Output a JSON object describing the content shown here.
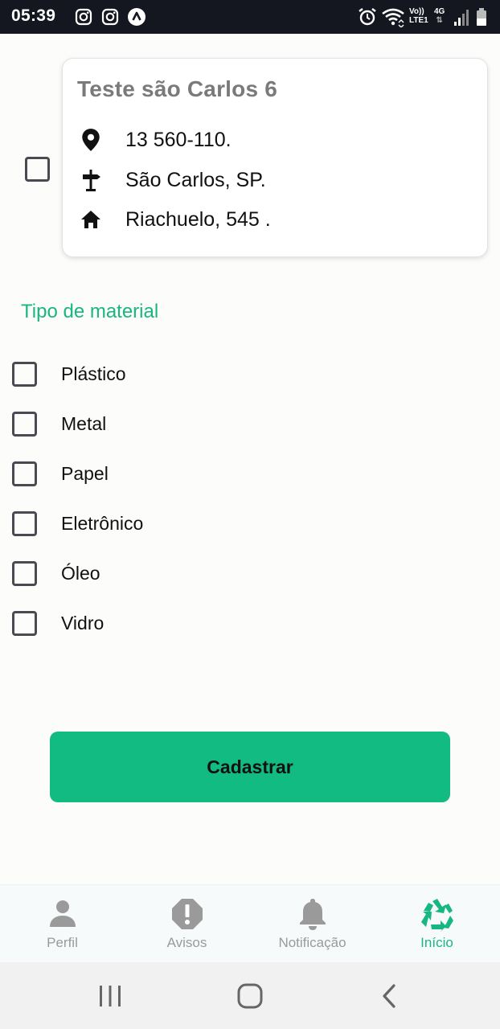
{
  "status_bar": {
    "time": "05:39",
    "icons_left": [
      "instagram-icon",
      "instagram-icon",
      "app-notification-icon"
    ],
    "icons_right": [
      "alarm-icon",
      "wifi-icon",
      "volte-lte1-icon",
      "4g-data-icon",
      "signal-icon",
      "battery-icon"
    ],
    "network_label_1": "Vo))",
    "network_label_2": "LTE1",
    "data_label": "4G"
  },
  "address_card": {
    "title": "Teste são Carlos 6",
    "cep": "13 560-110.",
    "city": "São Carlos, SP.",
    "street": "Riachuelo, 545 .",
    "checked": false
  },
  "material_section": {
    "title": "Tipo de material",
    "options": [
      {
        "label": "Plástico",
        "checked": false
      },
      {
        "label": "Metal",
        "checked": false
      },
      {
        "label": "Papel",
        "checked": false
      },
      {
        "label": "Eletrônico",
        "checked": false
      },
      {
        "label": "Óleo",
        "checked": false
      },
      {
        "label": "Vidro",
        "checked": false
      }
    ]
  },
  "submit_label": "Cadastrar",
  "tabs": [
    {
      "label": "Perfil",
      "icon": "person-icon",
      "active": false
    },
    {
      "label": "Avisos",
      "icon": "alert-octagon-icon",
      "active": false
    },
    {
      "label": "Notificação",
      "icon": "bell-icon",
      "active": false
    },
    {
      "label": "Início",
      "icon": "recycle-icon",
      "active": true
    }
  ],
  "colors": {
    "accent": "#12bb81",
    "accent_text": "#18b680",
    "inactive": "#9a9a9a",
    "status_bar": "#14171f"
  }
}
